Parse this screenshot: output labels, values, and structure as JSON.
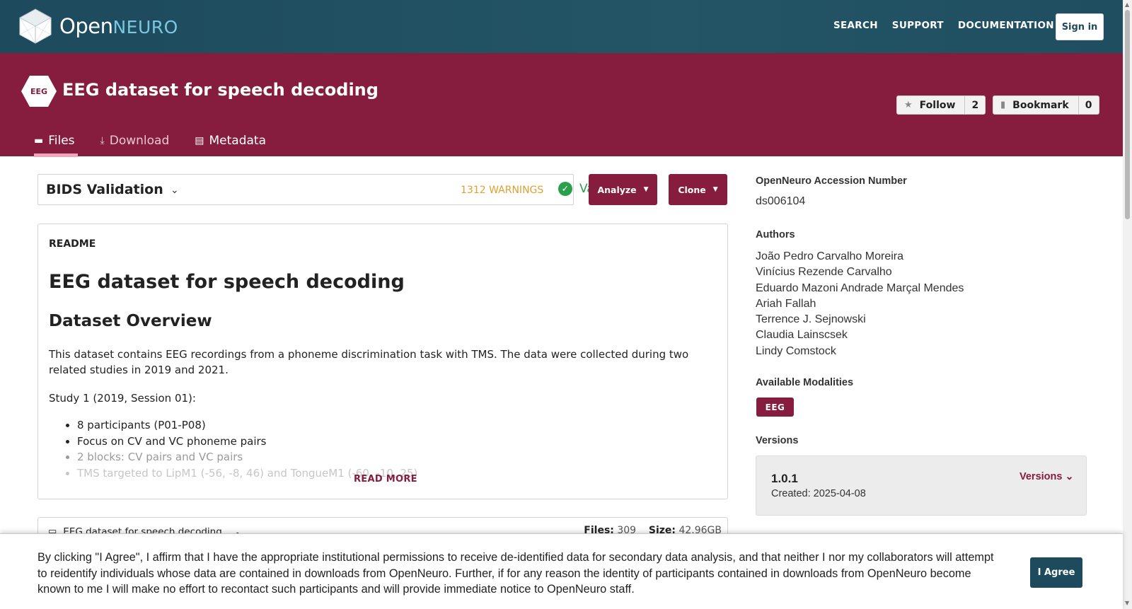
{
  "topnav": {
    "logo_open": "Open",
    "logo_neuro": "NEURO",
    "links": [
      "SEARCH",
      "SUPPORT",
      "DOCUMENTATION"
    ],
    "signin_label": "Sign in"
  },
  "dataset": {
    "modality_badge": "EEG",
    "title": "EEG dataset for speech decoding",
    "follow_label": "Follow",
    "follow_count": "2",
    "bookmark_label": "Bookmark",
    "bookmark_count": "0",
    "tabs": [
      "Files",
      "Download",
      "Metadata"
    ]
  },
  "bids": {
    "title": "BIDS Validation",
    "warnings": "1312 WARNINGS",
    "status": "Valid"
  },
  "actions": {
    "analyze_label": "Analyze",
    "clone_label": "Clone"
  },
  "readme": {
    "label": "README",
    "h1": "EEG dataset for speech decoding",
    "h2": "Dataset Overview",
    "p1": "This dataset contains EEG recordings from a phoneme discrimination task with TMS. The data were collected during two related studies in 2019 and 2021.",
    "p2": "Study 1 (2019, Session 01):",
    "bullets": [
      "8 participants (P01-P08)",
      "Focus on CV and VC phoneme pairs",
      "2 blocks: CV pairs and VC pairs",
      "TMS targeted to LipM1 (-56, -8, 46) and TongueM1 (-60, -10, 25)"
    ],
    "read_more": "READ MORE"
  },
  "files": {
    "name": "EEG dataset for speech decoding",
    "files_label": "Files:",
    "files_count": "309",
    "size_label": "Size:",
    "size_value": "42.96GB"
  },
  "sidebar": {
    "accession_heading": "OpenNeuro Accession Number",
    "accession_value": "ds006104",
    "authors_heading": "Authors",
    "authors": [
      "João Pedro Carvalho Moreira",
      "Vinícius Rezende Carvalho",
      "Eduardo Mazoni Andrade Marçal Mendes",
      "Ariah Fallah",
      "Terrence J. Sejnowski",
      "Claudia Lainscsek",
      "Lindy Comstock"
    ],
    "modalities_heading": "Available Modalities",
    "modalities": [
      "EEG"
    ],
    "versions_heading": "Versions",
    "version_number": "1.0.1",
    "version_created": "Created: 2025-04-08",
    "versions_link": "Versions"
  },
  "consent": {
    "text": "By clicking \"I Agree\", I affirm that I have the appropriate institutional permissions to receive de-identified data for secondary data analysis, and that neither I nor my collaborators will attempt to reidentify individuals whose data are contained in downloads from OpenNeuro. Further, if for any reason the identity of participants contained in downloads from OpenNeuro become known to me I will make no effort to recontact such participants and will provide immediate notice to OpenNeuro staff.",
    "agree_label": "I Agree"
  },
  "colors": {
    "nav": "#1d4a5c",
    "brand": "#861d3e",
    "valid": "#2ba04a",
    "warning": "#e0a030"
  },
  "icons": [
    "logo-cube-icon",
    "star-icon",
    "bookmark-icon",
    "folder-icon",
    "download-icon",
    "file-code-icon",
    "chevron-down-icon",
    "check-circle-icon",
    "caret-down-icon",
    "chevron-up-icon"
  ]
}
